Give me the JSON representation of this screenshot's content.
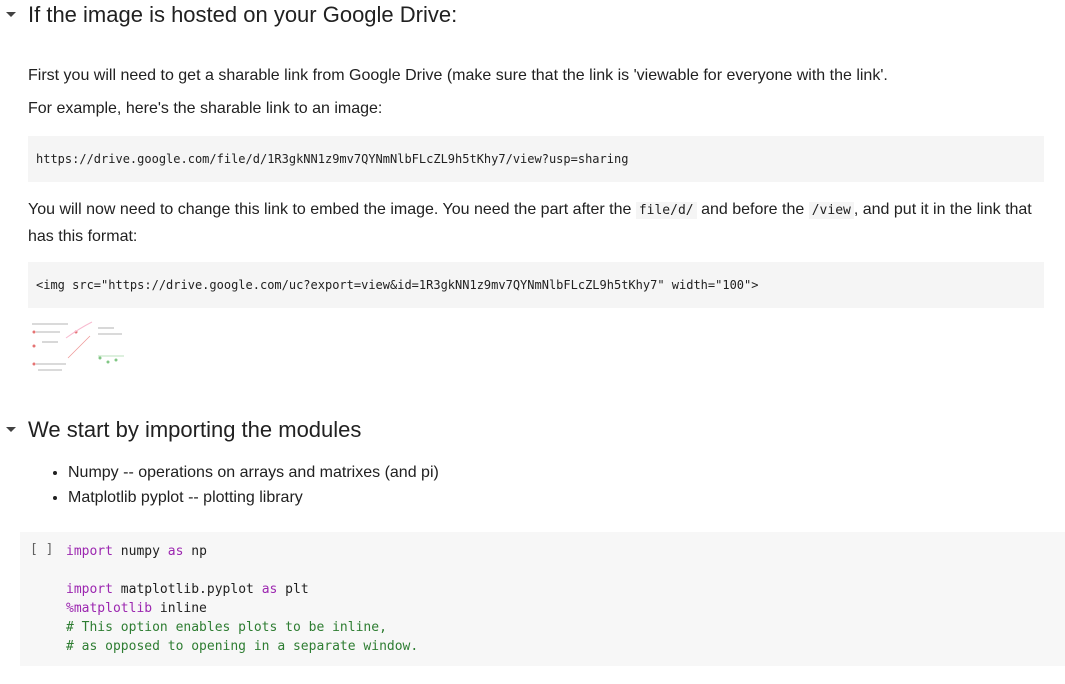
{
  "section1": {
    "heading": "If the image is hosted on your Google Drive:",
    "para1": "First you will need to get a sharable link from Google Drive (make sure that the link is 'viewable for everyone with the link'.",
    "para2": "For example, here's the sharable link to an image:",
    "code1": "https://drive.google.com/file/d/1R3gkNN1z9mv7QYNmNlbFLcZL9h5tKhy7/view?usp=sharing",
    "para3_a": "You will now need to change this link to embed the image. You need the part after the ",
    "para3_code1": "file/d/",
    "para3_b": " and before the ",
    "para3_code2": "/view",
    "para3_c": ", and put it in the link that",
    "para3_d": "has this format:",
    "code2": "<img src=\"https://drive.google.com/uc?export=view&id=1R3gkNN1z9mv7QYNmNlbFLcZL9h5tKhy7\" width=\"100\">"
  },
  "section2": {
    "heading": "We start by importing the modules",
    "bullets": [
      "Numpy -- operations on arrays and matrixes (and pi)",
      "Matplotlib pyplot -- plotting library"
    ]
  },
  "code_cell": {
    "run_label": "[ ]",
    "line1_kw": "import",
    "line1_mod": " numpy ",
    "line1_as": "as",
    "line1_alias": " np",
    "line2_kw": "import",
    "line2_mod": " matplotlib.pyplot ",
    "line2_as": "as",
    "line2_alias": " plt",
    "line3_magic": "%matplotlib",
    "line3_rest": " inline",
    "line4": "# This option enables plots to be inline,",
    "line5": "# as opposed to opening in a separate window."
  },
  "colors": {
    "keyword": "#9c27b0",
    "comment": "#2e7d32",
    "code_bg": "#f5f5f5"
  },
  "icons": [
    "caret-down-icon",
    "thumbnail-image"
  ]
}
